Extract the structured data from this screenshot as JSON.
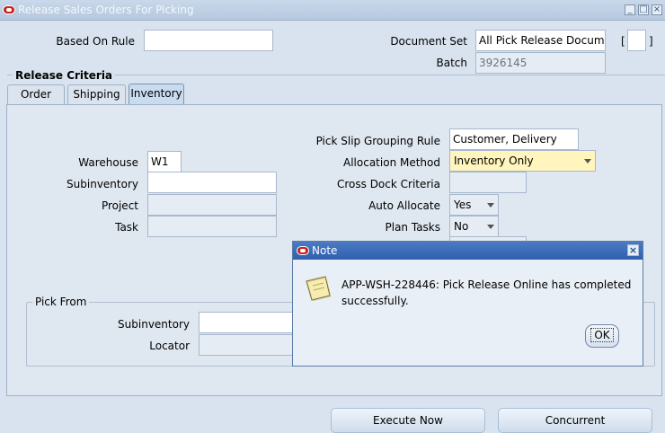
{
  "window": {
    "title": "Release Sales Orders For Picking",
    "controls": [
      "minimize-icon",
      "maximize-icon",
      "close-icon"
    ]
  },
  "header": {
    "based_on_rule_label": "Based On Rule",
    "based_on_rule_value": "",
    "document_set_label": "Document Set",
    "document_set_value": "All Pick Release Docum",
    "bracket_left": "[",
    "bracket_right": "]",
    "batch_label": "Batch",
    "batch_value": "3926145"
  },
  "release_criteria": {
    "title": "Release Criteria",
    "tabs": [
      {
        "label": "Order",
        "active": false
      },
      {
        "label": "Shipping",
        "active": false
      },
      {
        "label": "Inventory",
        "active": true
      }
    ]
  },
  "inventory": {
    "warehouse_label": "Warehouse",
    "warehouse_value": "W1",
    "subinventory_label": "Subinventory",
    "subinventory_value": "",
    "project_label": "Project",
    "project_value": "",
    "task_label": "Task",
    "task_value": "",
    "pick_slip_label": "Pick Slip Grouping Rule",
    "pick_slip_value": "Customer, Delivery",
    "allocation_method_label": "Allocation Method",
    "allocation_method_value": "Inventory Only",
    "cross_dock_label": "Cross Dock Criteria",
    "cross_dock_value": "",
    "auto_allocate_label": "Auto Allocate",
    "auto_allocate_value": "Yes",
    "plan_tasks_label": "Plan Tasks",
    "plan_tasks_value": "No"
  },
  "pick_from": {
    "title": "Pick From",
    "subinventory_label": "Subinventory",
    "subinventory_value": "",
    "locator_label": "Locator",
    "locator_value": ""
  },
  "buttons": {
    "execute_now": "Execute Now",
    "concurrent": "Concurrent"
  },
  "dialog": {
    "title": "Note",
    "message_line1": "APP-WSH-228446: Pick Release Online has completed",
    "message_line2": "successfully.",
    "ok_label": "OK",
    "icon": "note-icon"
  },
  "colors": {
    "background": "#d9e3ef",
    "dialog_title": "#2f5fae",
    "highlight_field": "#fff5bd",
    "oracle_red": "#cc2020"
  }
}
